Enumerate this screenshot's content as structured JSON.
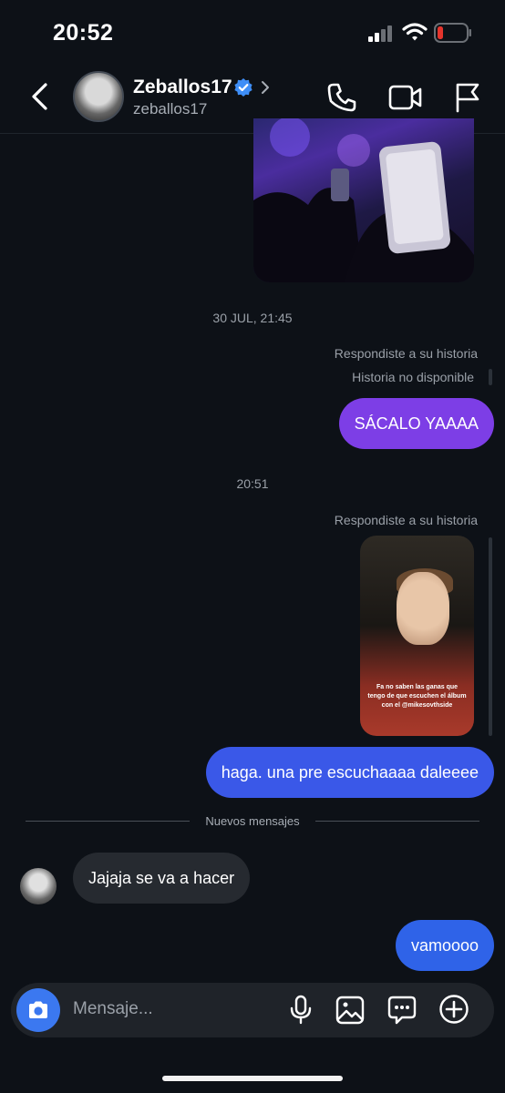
{
  "status_bar": {
    "time": "20:52",
    "icons": [
      "signal-icon",
      "wifi-icon",
      "battery-icon"
    ]
  },
  "header": {
    "title": "Zeballos17",
    "subtitle": "zeballos17",
    "icons": [
      "back-chevron-icon",
      "verified-badge-icon",
      "chevron-right-icon",
      "phone-icon",
      "video-call-icon",
      "flag-icon"
    ]
  },
  "colors": {
    "background": "#0d1117",
    "outgoing_purple": "#7d3ee6",
    "outgoing_blue": "#3a58e8",
    "incoming_gray": "#262a30",
    "accent_blue": "#3b78f0"
  },
  "messages": {
    "date_stamp_1": "30 JUL, 21:45",
    "reply_label_1": "Respondiste a su historia",
    "unavailable_label": "Historia no disponible",
    "bubble_1": "SÁCALO YAAAA",
    "time_stamp_2": "20:51",
    "reply_label_2": "Respondiste a su historia",
    "story_caption": "Fa no saben las ganas que tengo de que escuchen el álbum con el @mikesovthside",
    "bubble_2": "haga. una pre escuchaaaa daleeee",
    "new_messages_divider": "Nuevos mensajes",
    "bubble_3": "Jajaja se va a hacer",
    "bubble_4": "vamoooo"
  },
  "composer": {
    "placeholder": "Mensaje...",
    "icons": [
      "camera-icon",
      "microphone-icon",
      "gallery-icon",
      "sticker-icon",
      "add-icon"
    ]
  }
}
